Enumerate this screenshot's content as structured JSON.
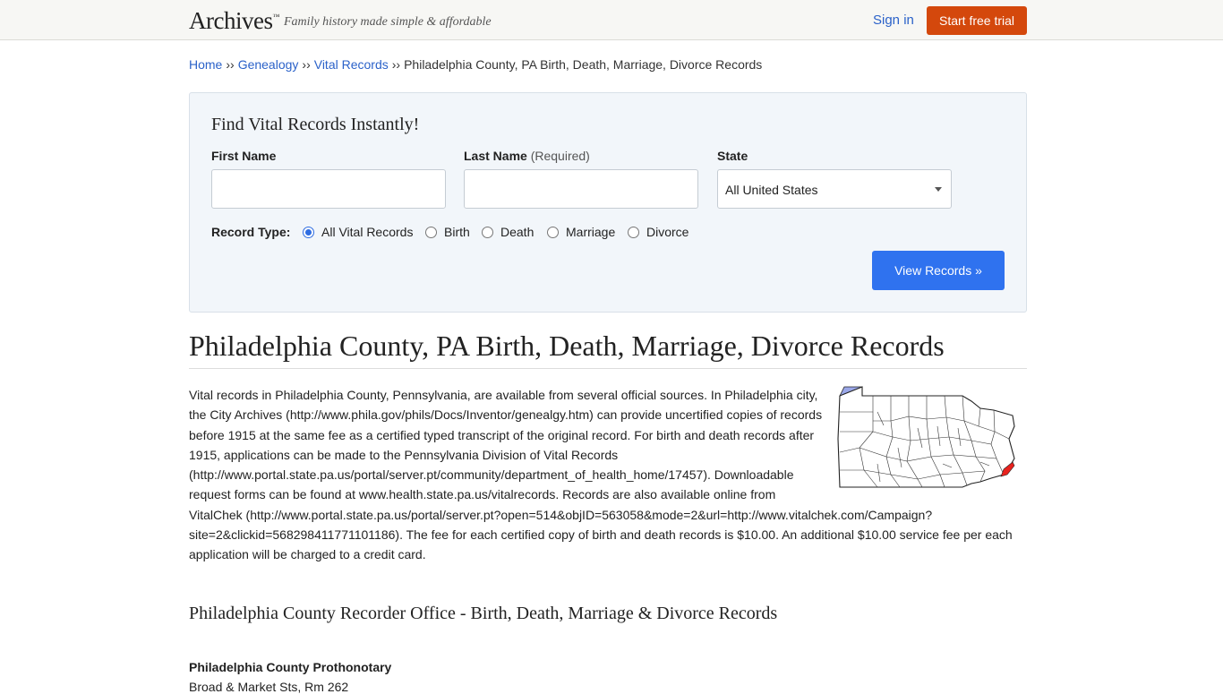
{
  "header": {
    "logo": "Archives",
    "logo_tm": "™",
    "tagline": "Family history made simple & affordable",
    "signin_label": "Sign in",
    "trial_label": "Start free trial"
  },
  "breadcrumb": {
    "home": "Home",
    "genealogy": "Genealogy",
    "vital": "Vital Records",
    "current": "Philadelphia County, PA Birth, Death, Marriage, Divorce Records",
    "separator": "››"
  },
  "search": {
    "title": "Find Vital Records Instantly!",
    "first_name_label": "First Name",
    "last_name_label": "Last Name",
    "last_name_required": "(Required)",
    "state_label": "State",
    "state_value": "All United States",
    "first_name_value": "",
    "last_name_value": "",
    "record_type_label": "Record Type:",
    "record_types": [
      "All Vital Records",
      "Birth",
      "Death",
      "Marriage",
      "Divorce"
    ],
    "selected_record_type": "All Vital Records",
    "submit_label": "View Records »"
  },
  "content": {
    "title": "Philadelphia County, PA Birth, Death, Marriage, Divorce Records",
    "paragraph": "Vital records in Philadelphia County, Pennsylvania, are available from several official sources. In Philadelphia city, the City Archives (http://www.phila.gov/phils/Docs/Inventor/genealgy.htm) can provide uncertified copies of records before 1915 at the same fee as a certified typed transcript of the original record. For birth and death records after 1915, applications can be made to the Pennsylvania Division of Vital Records (http://www.portal.state.pa.us/portal/server.pt/community/department_of_health_home/17457). Downloadable request forms can be found at www.health.state.pa.us/vitalrecords. Records are also available online from VitalChek (http://www.portal.state.pa.us/portal/server.pt?open=514&objID=563058&mode=2&url=http://www.vitalchek.com/Campaign?site=2&clickid=568298411771101186). The fee for each certified copy of birth and death records is $10.00. An additional $10.00 service fee per each application will be charged to a credit card.",
    "section_title": "Philadelphia County Recorder Office - Birth, Death, Marriage & Divorce Records",
    "office_name": "Philadelphia County Prothonotary",
    "office_address": "Broad & Market Sts, Rm 262"
  },
  "map": {
    "icon": "pennsylvania-county-map",
    "highlight_color": "#e8221e",
    "lake_color": "#9aa7e8"
  },
  "colors": {
    "link": "#2b62c9",
    "trial_button": "#d4480c",
    "view_button": "#2f72ef",
    "panel_bg": "#f2f6fa"
  }
}
